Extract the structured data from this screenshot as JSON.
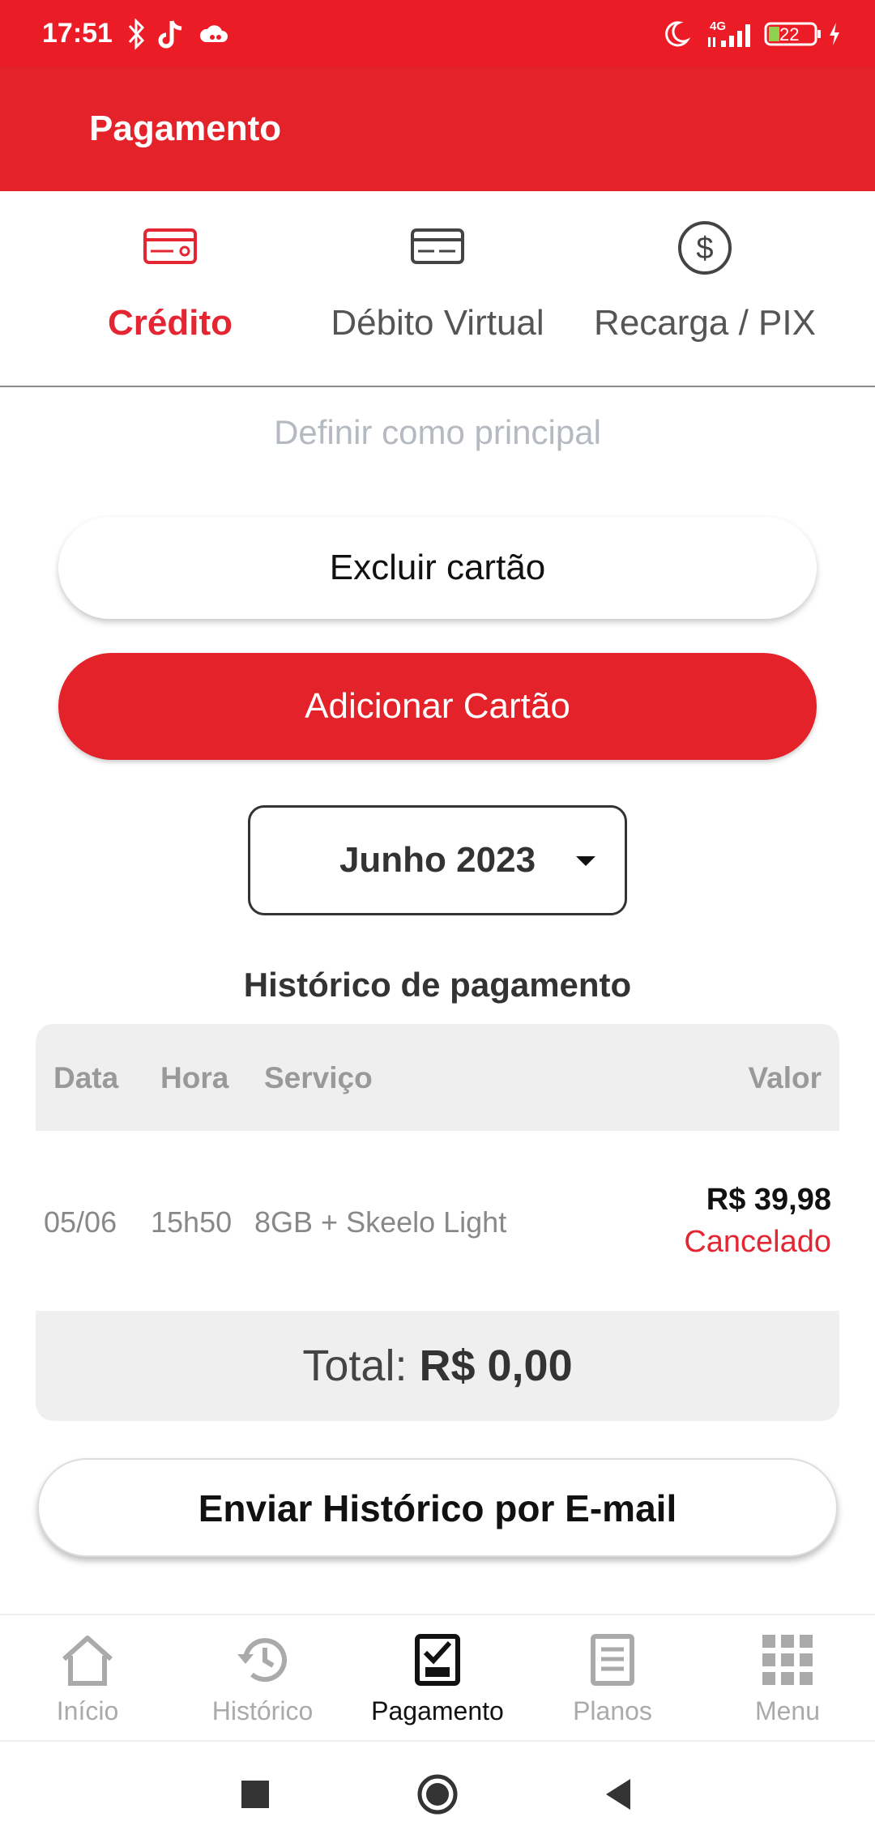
{
  "status_bar": {
    "time": "17:51",
    "network": "4G",
    "battery": "22"
  },
  "app_bar": {
    "title": "Pagamento"
  },
  "tabs": [
    {
      "label": "Crédito",
      "icon": "credit-card-icon",
      "active": true
    },
    {
      "label": "Débito Virtual",
      "icon": "debit-card-icon",
      "active": false
    },
    {
      "label": "Recarga / PIX",
      "icon": "dollar-circle-icon",
      "active": false
    }
  ],
  "set_primary_label": "Definir como principal",
  "delete_card_label": "Excluir cartão",
  "add_card_label": "Adicionar Cartão",
  "month_select": {
    "value": "Junho 2023"
  },
  "history": {
    "title": "Histórico de pagamento",
    "columns": [
      "Data",
      "Hora",
      "Serviço",
      "Valor"
    ],
    "rows": [
      {
        "date": "05/06",
        "time": "15h50",
        "service": "8GB + Skeelo Light",
        "value": "R$ 39,98",
        "status": "Cancelado"
      }
    ],
    "total_label": "Total:",
    "total_value": "R$ 0,00"
  },
  "email_button_label": "Enviar Histórico por E-mail",
  "bottom_nav": [
    {
      "label": "Início",
      "icon": "home-icon",
      "active": false
    },
    {
      "label": "Histórico",
      "icon": "history-icon",
      "active": false
    },
    {
      "label": "Pagamento",
      "icon": "payment-icon",
      "active": true
    },
    {
      "label": "Planos",
      "icon": "plans-icon",
      "active": false
    },
    {
      "label": "Menu",
      "icon": "menu-grid-icon",
      "active": false
    }
  ],
  "colors": {
    "brand_red": "#e42229",
    "status_red": "#ec1c27",
    "active_red": "#e32631",
    "muted_gray": "#b5b9c0"
  }
}
